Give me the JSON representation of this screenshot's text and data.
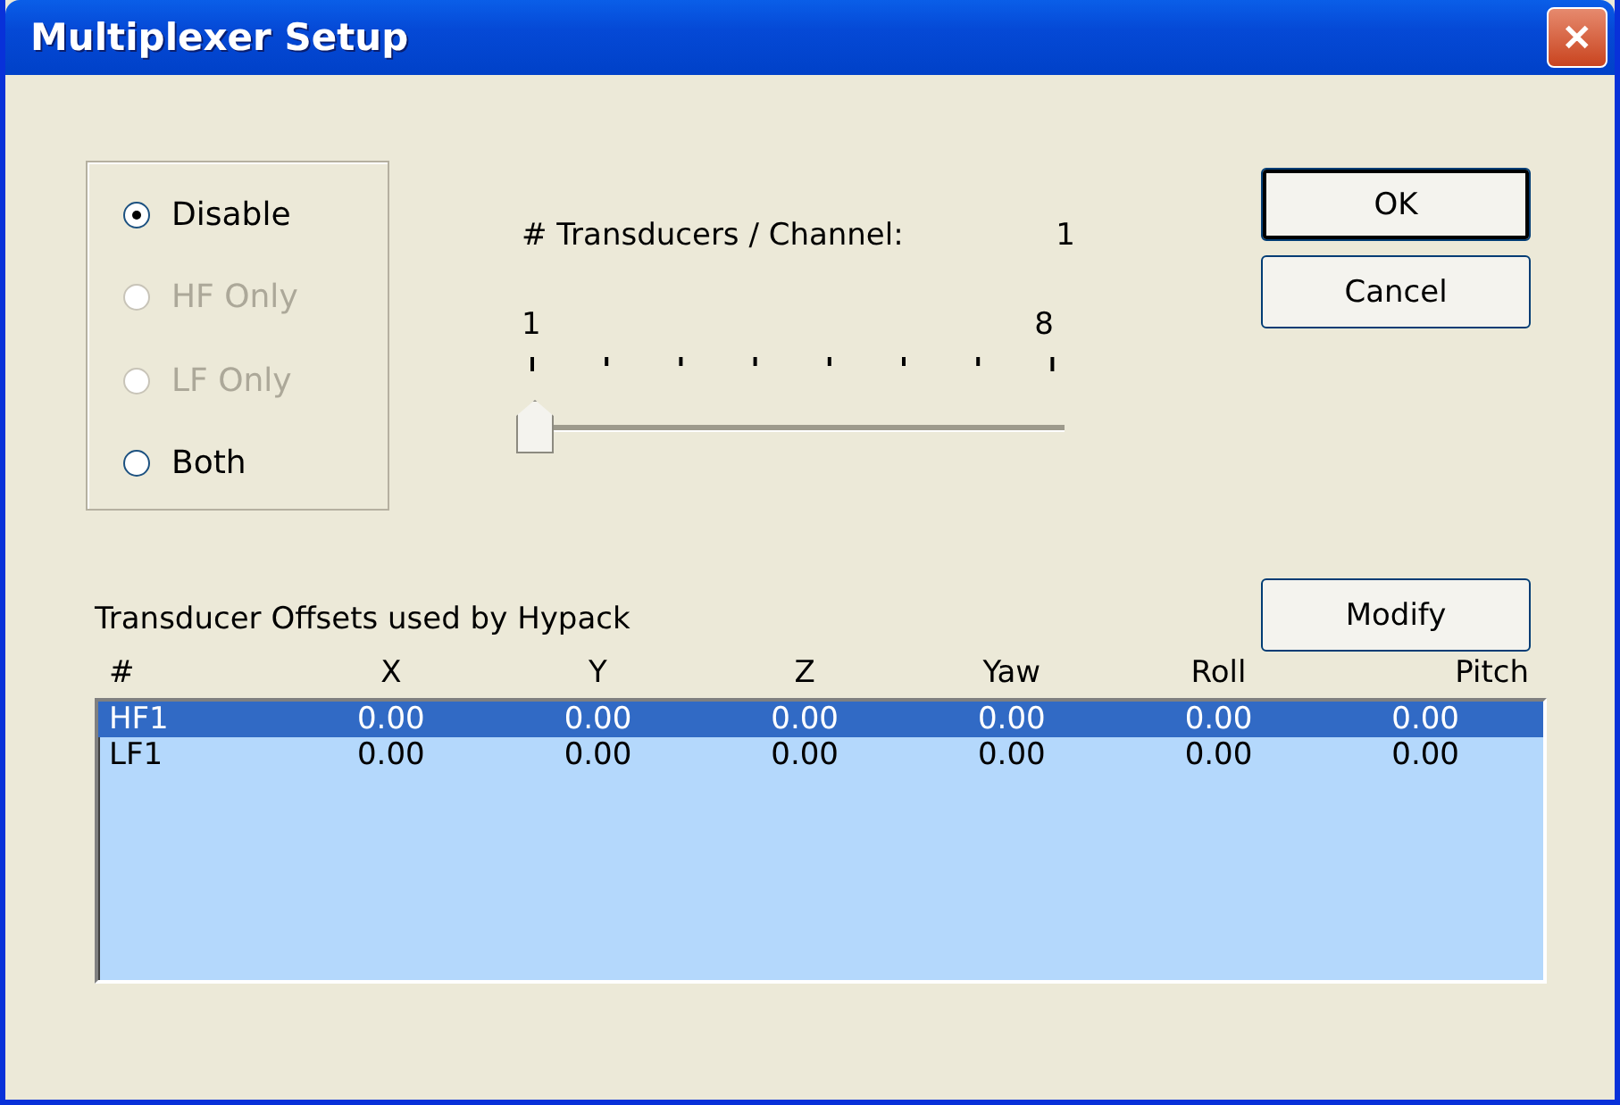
{
  "window": {
    "title": "Multiplexer Setup",
    "close": "✕"
  },
  "mode_options": [
    {
      "label": "Disable",
      "selected": true,
      "disabled": false
    },
    {
      "label": "HF Only",
      "selected": false,
      "disabled": true
    },
    {
      "label": "LF Only",
      "selected": false,
      "disabled": true
    },
    {
      "label": "Both",
      "selected": false,
      "disabled": false
    }
  ],
  "slider": {
    "label": "# Transducers / Channel:",
    "reading": "1",
    "min_label": "1",
    "max_label": "8",
    "level": 0
  },
  "buttons": {
    "ok": "OK",
    "cancel": "Cancel",
    "modify": "Modify"
  },
  "table": {
    "caption": "Transducer Offsets used by Hypack",
    "columns": [
      "#",
      "X",
      "Y",
      "Z",
      "Yaw",
      "Roll",
      "Pitch"
    ],
    "rows": [
      {
        "cells": [
          "HF1",
          "0.00",
          "0.00",
          "0.00",
          "0.00",
          "0.00",
          "0.00"
        ],
        "selected": true
      },
      {
        "cells": [
          "LF1",
          "0.00",
          "0.00",
          "0.00",
          "0.00",
          "0.00",
          "0.00"
        ],
        "selected": false
      }
    ]
  }
}
